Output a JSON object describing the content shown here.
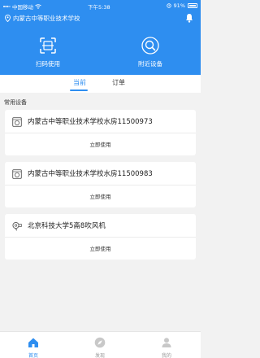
{
  "status_bar": {
    "carrier": "中国移动",
    "time": "下午5:38",
    "battery": "91%"
  },
  "header": {
    "location": "内蒙古中等职业技术学校"
  },
  "actions": {
    "scan_label": "扫码使用",
    "nearby_label": "附近设备"
  },
  "tabs": {
    "current": "当前",
    "orders": "订单"
  },
  "section": {
    "title": "常用设备"
  },
  "devices": [
    {
      "name": "内蒙古中等职业技术学校水房11500973",
      "action": "立即使用",
      "icon": "washer-icon"
    },
    {
      "name": "内蒙古中等职业技术学校水房11500983",
      "action": "立即使用",
      "icon": "washer-icon"
    },
    {
      "name": "北京科技大学5斋8吹风机",
      "action": "立即使用",
      "icon": "hairdryer-icon"
    }
  ],
  "bottom_nav": {
    "home": "首页",
    "discover": "发现",
    "mine": "我的"
  },
  "colors": {
    "primary": "#2e8ef0",
    "background": "#f2f2f2"
  }
}
